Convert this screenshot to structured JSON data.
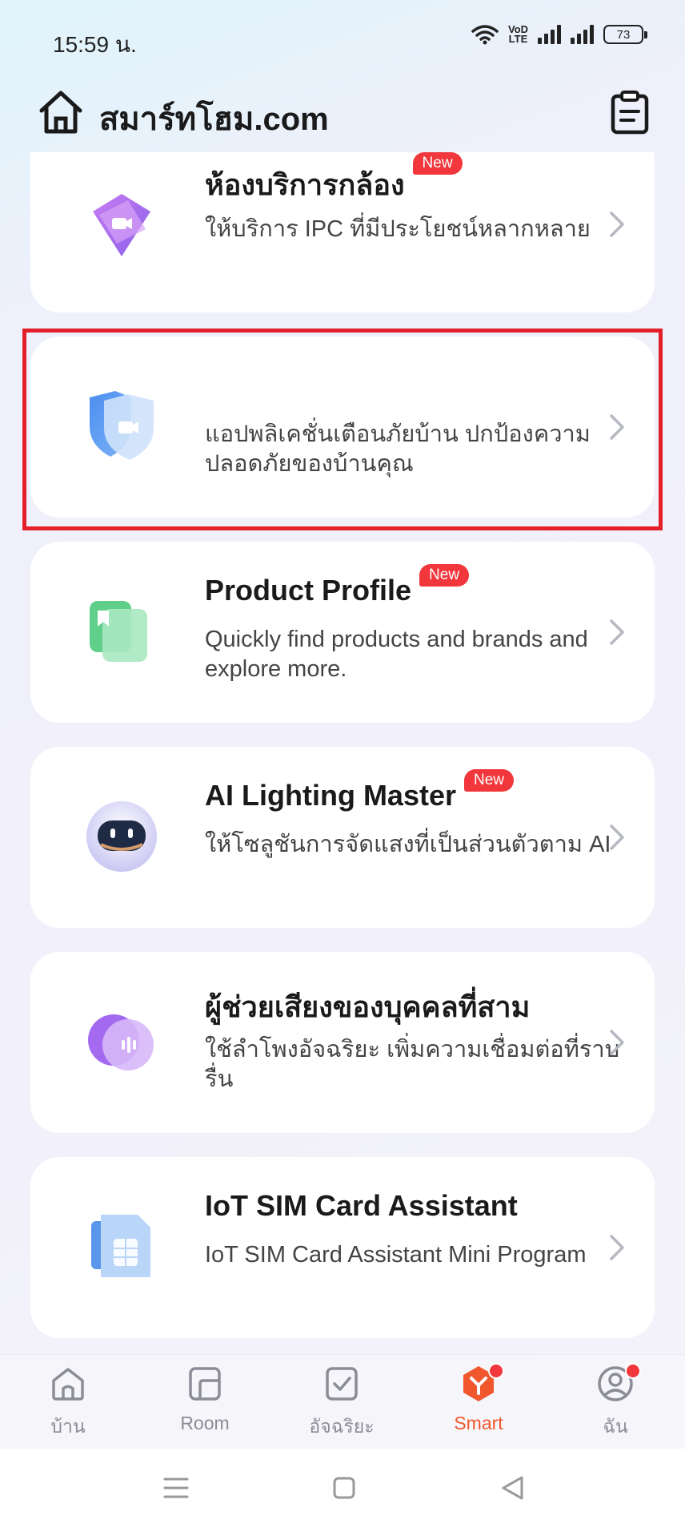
{
  "status_bar": {
    "time": "15:59 น.",
    "volte_top": "VoD",
    "volte_bottom": "LTE",
    "battery": "73"
  },
  "header": {
    "title": "สมาร์ทโฮม.com"
  },
  "cards": [
    {
      "title": "ห้องบริการกล้อง",
      "badge": "New",
      "desc": "ให้บริการ IPC ที่มีประโยชน์หลากหลาย",
      "icon": "camera-service-icon"
    },
    {
      "title": "",
      "badge": "",
      "desc": "แอปพลิเคชั่นเตือนภัยบ้าน ปกป้องความปลอดภัยของบ้านคุณ",
      "icon": "home-security-icon"
    },
    {
      "title": "Product Profile",
      "badge": "New",
      "desc": "Quickly find products and brands and explore more.",
      "icon": "product-profile-icon"
    },
    {
      "title": "AI Lighting Master",
      "badge": "New",
      "desc": "ให้โซลูชันการจัดแสงที่เป็นส่วนตัวตาม AI",
      "icon": "ai-robot-icon"
    },
    {
      "title": "ผู้ช่วยเสียงของบุคคลที่สาม",
      "badge": "",
      "desc": "ใช้ลำโพงอัจฉริยะ เพิ่มความเชื่อมต่อที่ราบรื่น",
      "icon": "voice-assistant-icon"
    },
    {
      "title": "IoT SIM Card Assistant",
      "badge": "",
      "desc": "IoT SIM Card Assistant Mini Program",
      "icon": "sim-card-icon"
    }
  ],
  "bottom_nav": [
    {
      "label": "บ้าน",
      "icon": "home-icon",
      "active": false
    },
    {
      "label": "Room",
      "icon": "room-icon",
      "active": false
    },
    {
      "label": "อัจฉริยะ",
      "icon": "smart-check-icon",
      "active": false
    },
    {
      "label": "Smart",
      "icon": "smart-logo-icon",
      "active": true
    },
    {
      "label": "ฉัน",
      "icon": "profile-icon",
      "active": false
    }
  ],
  "colors": {
    "accent": "#f0572d",
    "badge": "#f1373c",
    "highlight": "#e3202a"
  }
}
